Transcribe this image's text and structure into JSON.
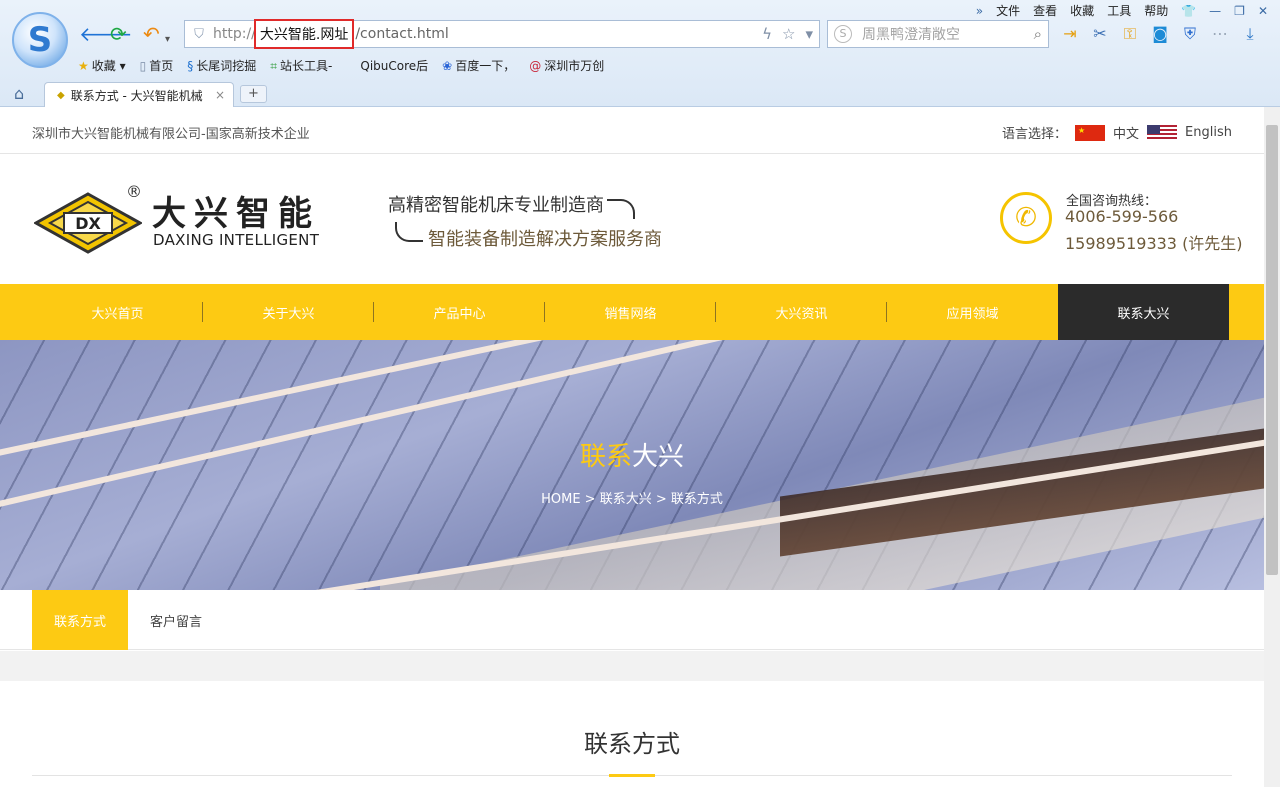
{
  "browser": {
    "menu": [
      "文件",
      "查看",
      "收藏",
      "工具",
      "帮助"
    ],
    "address": {
      "protocol": "http://",
      "highlight": "大兴智能.网址",
      "path": "/contact.html"
    },
    "search_placeholder": "周黑鸭澄清敞空",
    "bookmarks": [
      "收藏",
      "首页",
      "长尾词挖掘",
      "站长工具-",
      "QibuCore后",
      "百度一下，",
      "深圳市万创"
    ],
    "tab_title": "联系方式 - 大兴智能机械",
    "tab_close": "×",
    "new_tab": "+"
  },
  "site": {
    "company_line": "深圳市大兴智能机械有限公司-国家高新技术企业",
    "lang_label": "语言选择：",
    "lang_cn": "中文",
    "lang_en": "English",
    "logo_cn": "大兴智能",
    "logo_en": "DAXING INTELLIGENT",
    "logo_mark": "DX",
    "slogan_1": "高精密智能机床专业制造商",
    "slogan_2": "智能装备制造解决方案服务商",
    "hotline_label": "全国咨询热线：",
    "hotline_1": "4006-599-566",
    "hotline_2": "15989519333 (许先生)"
  },
  "nav": [
    "大兴首页",
    "关于大兴",
    "产品中心",
    "销售网络",
    "大兴资讯",
    "应用领域",
    "联系大兴"
  ],
  "banner": {
    "title_yellow": "联系",
    "title_white": "大兴",
    "breadcrumb": "HOME > 联系大兴 > 联系方式"
  },
  "subnav": {
    "active": "联系方式",
    "other": "客户留言"
  },
  "section_title": "联系方式",
  "colors": {
    "accent": "#fdca13",
    "nav_active": "#2b2b2b",
    "highlight_box": "#e02a2a"
  }
}
